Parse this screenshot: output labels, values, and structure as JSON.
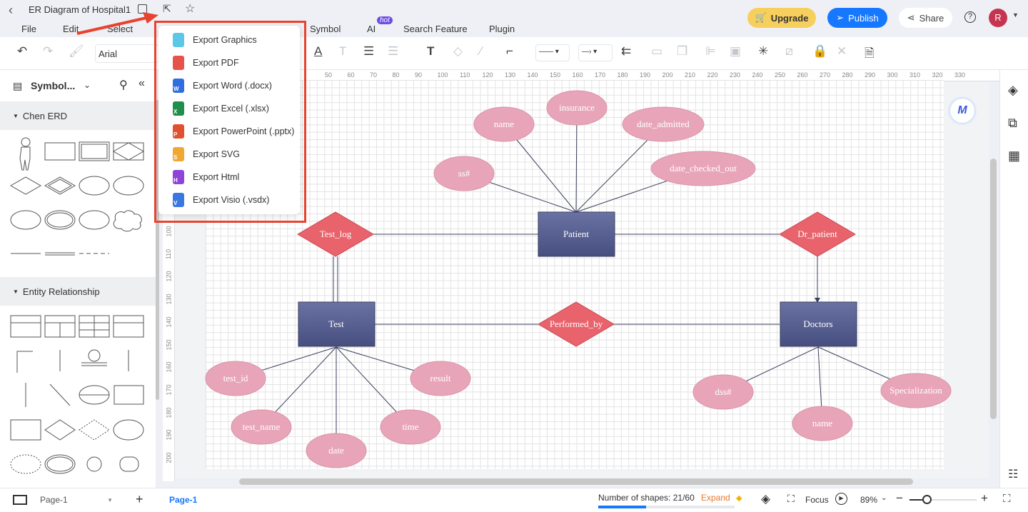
{
  "title": "ER Diagram of Hospital1",
  "menu": [
    "File",
    "Edit",
    "Select",
    "Symbol",
    "AI",
    "Search Feature",
    "Plugin"
  ],
  "ai_badge": "hot",
  "header": {
    "upgrade": "Upgrade",
    "publish": "Publish",
    "share": "Share",
    "avatar": "R",
    "colors": {
      "upgrade": "#f7cf5d",
      "publish": "#1677ff",
      "avatar": "#c7344f"
    }
  },
  "toolbar": {
    "font": "Arial"
  },
  "export_menu": [
    {
      "label": "Export Graphics",
      "icon": "graphics-file-icon",
      "letter": "",
      "color": "#5cc8e8"
    },
    {
      "label": "Export PDF",
      "icon": "pdf-file-icon",
      "letter": "",
      "color": "#e5534b"
    },
    {
      "label": "Export Word (.docx)",
      "icon": "word-file-icon",
      "letter": "W",
      "color": "#2f6ee0"
    },
    {
      "label": "Export Excel (.xlsx)",
      "icon": "excel-file-icon",
      "letter": "X",
      "color": "#1f8f4c"
    },
    {
      "label": "Export PowerPoint (.pptx)",
      "icon": "powerpoint-file-icon",
      "letter": "P",
      "color": "#e0512f"
    },
    {
      "label": "Export SVG",
      "icon": "svg-file-icon",
      "letter": "S",
      "color": "#f0a832"
    },
    {
      "label": "Export Html",
      "icon": "html-file-icon",
      "letter": "H",
      "color": "#8e44d8"
    },
    {
      "label": "Export Visio (.vsdx)",
      "icon": "visio-file-icon",
      "letter": "V",
      "color": "#3a78e0"
    }
  ],
  "sidebar": {
    "title": "Symbol...",
    "sections": [
      "Chen ERD",
      "Entity Relationship"
    ]
  },
  "ruler_h": [
    "50",
    "60",
    "70",
    "80",
    "90",
    "100",
    "110",
    "120",
    "130",
    "140",
    "150",
    "160",
    "170",
    "180",
    "190",
    "200",
    "210",
    "220",
    "230",
    "240",
    "250",
    "260",
    "270",
    "280",
    "290",
    "300",
    "310",
    "320",
    "330"
  ],
  "ruler_v": [
    "100",
    "110",
    "120",
    "130",
    "140",
    "150",
    "160",
    "170",
    "180",
    "190",
    "200"
  ],
  "diagram": {
    "entities": [
      {
        "label": "Patient"
      },
      {
        "label": "Test"
      },
      {
        "label": "Doctors"
      }
    ],
    "relationships": [
      {
        "label": "Test_log"
      },
      {
        "label": "Dr_patient"
      },
      {
        "label": "Performed_by"
      }
    ],
    "attributes": [
      {
        "label": "name",
        "entity": "Patient"
      },
      {
        "label": "insurance",
        "entity": "Patient"
      },
      {
        "label": "date_admitted",
        "entity": "Patient"
      },
      {
        "label": "ss#",
        "entity": "Patient"
      },
      {
        "label": "date_checked_out",
        "entity": "Patient"
      },
      {
        "label": "test_id",
        "entity": "Test"
      },
      {
        "label": "result",
        "entity": "Test"
      },
      {
        "label": "test_name",
        "entity": "Test"
      },
      {
        "label": "time",
        "entity": "Test"
      },
      {
        "label": "date",
        "entity": "Test"
      },
      {
        "label": "dss#",
        "entity": "Doctors"
      },
      {
        "label": "name",
        "entity": "Doctors"
      },
      {
        "label": "Specialization",
        "entity": "Doctors"
      }
    ],
    "colors": {
      "entity": "#555d8f",
      "relationship": "#e8636b",
      "attribute": "#e8a5b9"
    }
  },
  "bottom": {
    "page_select": "Page-1",
    "page_tab": "Page-1",
    "shapes": "Number of shapes: 21/60",
    "shapes_fraction": 0.35,
    "expand": "Expand",
    "focus": "Focus",
    "zoom": "89%",
    "zoom_fraction": 0.25
  }
}
